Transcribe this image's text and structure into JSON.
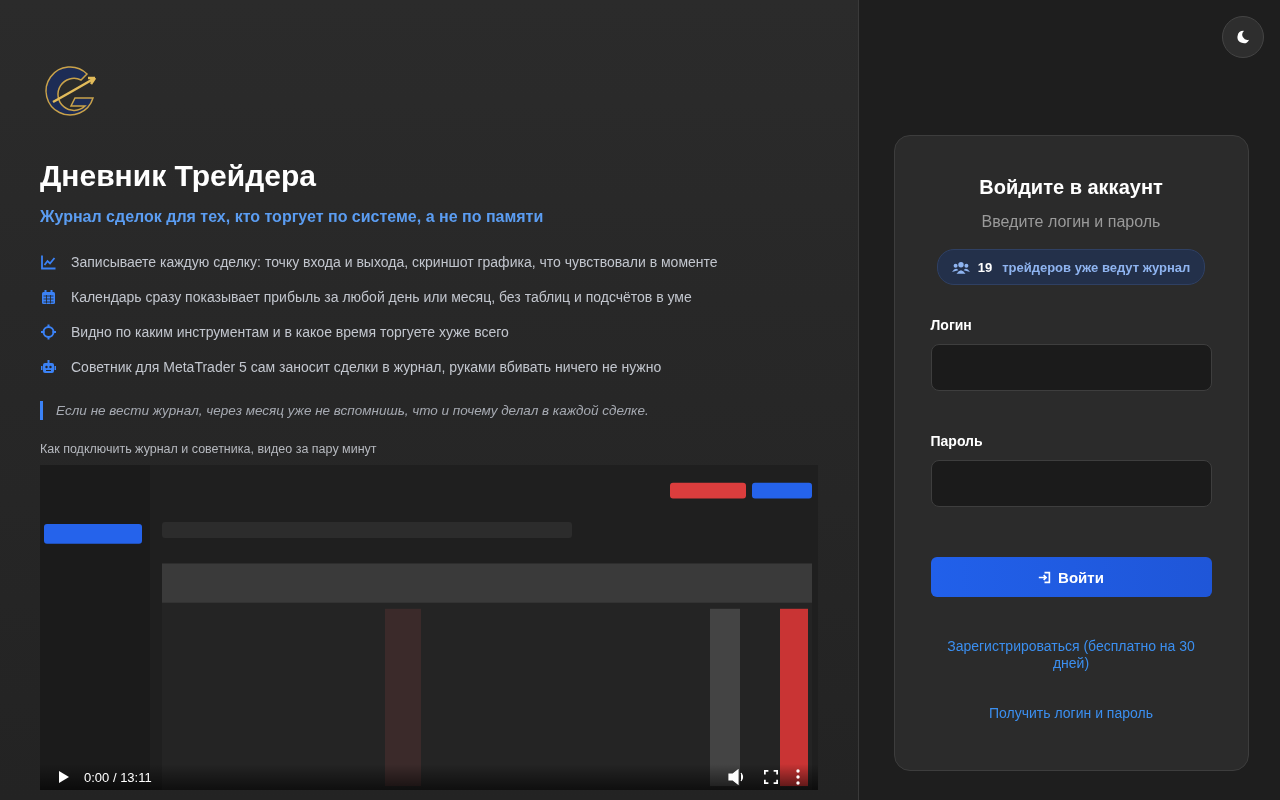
{
  "brand": {
    "title": "Дневник Трейдера",
    "tagline": "Журнал сделок для тех, кто торгует по системе, а не по памяти"
  },
  "features": [
    {
      "text": "Записываете каждую сделку: точку входа и выхода, скриншот графика, что чувствовали в моменте"
    },
    {
      "text": "Календарь сразу показывает прибыль за любой день или месяц, без таблиц и подсчётов в уме"
    },
    {
      "text": "Видно по каким инструментам и в какое время торгуете хуже всего"
    },
    {
      "text": "Советник для MetaTrader 5 сам заносит сделки в журнал, руками вбивать ничего не нужно"
    }
  ],
  "quote": "Если не вести журнал, через месяц уже не вспомнишь, что и почему делал в каждой сделке.",
  "video": {
    "caption": "Как подключить журнал и советника, видео за пару минут",
    "kind": "picture",
    "time": "0:00 / 13:11"
  },
  "login": {
    "title": "Войдите в аккаунт",
    "subtitle": "Введите логин и пароль",
    "traders_count": "19",
    "traders_text": "трейдеров уже ведут журнал",
    "fields": [
      {
        "label": "Логин"
      },
      {
        "label": "Пароль"
      }
    ],
    "submit": "Войти",
    "register_link": "Зарегистрироваться (бесплатно на 30 дней)",
    "credentials_link": "Получить логин и пароль"
  }
}
